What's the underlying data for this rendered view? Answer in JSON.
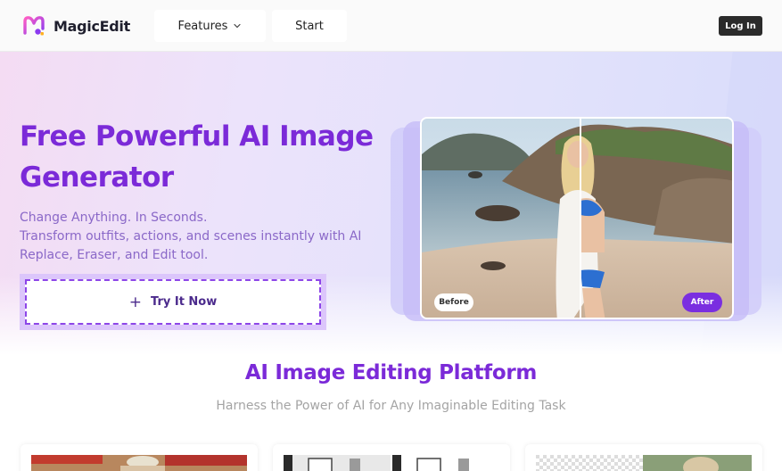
{
  "header": {
    "brand": "MagicEdit",
    "nav": {
      "features_label": "Features",
      "start_label": "Start"
    },
    "login_label": "Log In"
  },
  "hero": {
    "title": "Free Powerful AI Image Generator",
    "subtitle_line1": "Change Anything. In Seconds.",
    "subtitle_line2": "Transform outfits, actions, and scenes instantly with AI Replace, Eraser, and Edit tool.",
    "cta_label": "Try It Now",
    "compare": {
      "before_label": "Before",
      "after_label": "After"
    }
  },
  "platform": {
    "title": "AI Image Editing Platform",
    "subtitle": "Harness the Power of AI for Any Imaginable Editing Task"
  },
  "colors": {
    "accent": "#7b2ad8",
    "cta_border": "#8d46e8",
    "after_pill": "#7a2ee0",
    "login_bg": "#2b2b2b"
  },
  "icons": [
    "magicedit-logo-icon",
    "chevron-down-icon",
    "plus-icon"
  ]
}
